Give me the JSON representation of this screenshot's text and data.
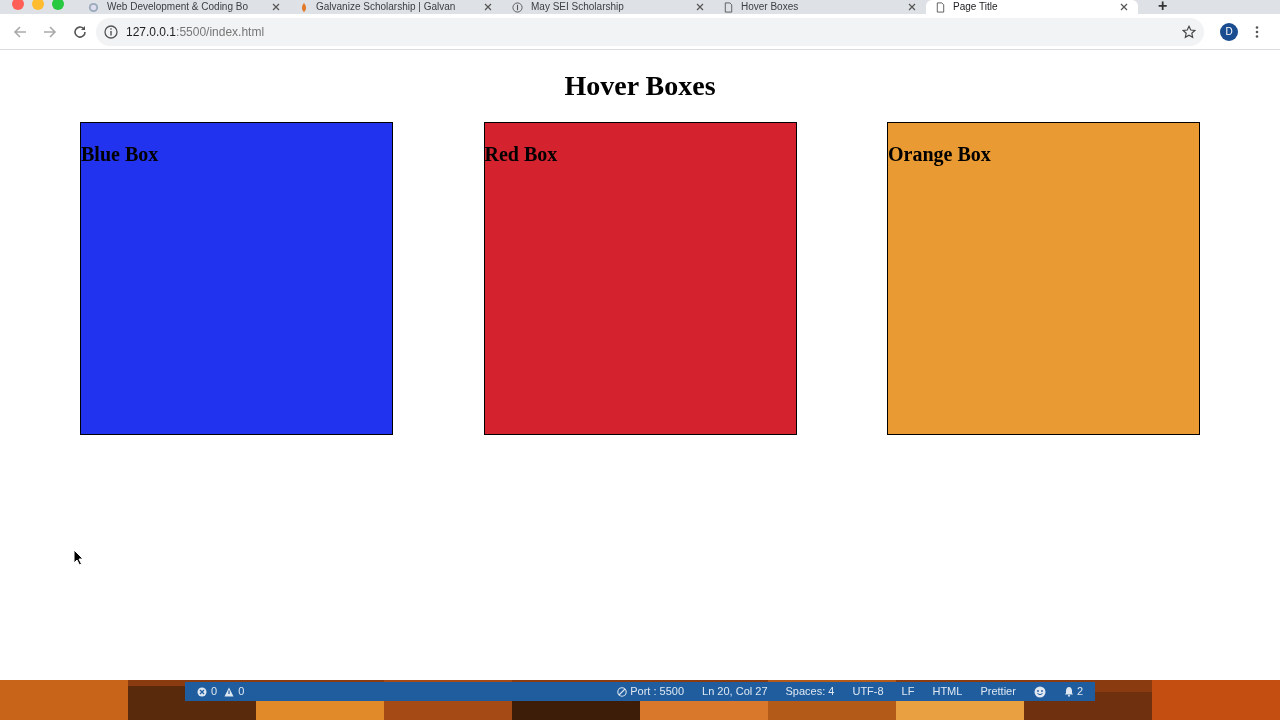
{
  "browser": {
    "tabs": [
      {
        "title": "Web Development & Coding Bo",
        "selected": false
      },
      {
        "title": "Galvanize Scholarship | Galvan",
        "selected": false
      },
      {
        "title": "May SEI Scholarship",
        "selected": false
      },
      {
        "title": "Hover Boxes",
        "selected": false
      },
      {
        "title": "Page Title",
        "selected": true
      }
    ],
    "new_tab": "+",
    "address": {
      "host": "127.0.0.1",
      "rest": ":5500/index.html"
    },
    "profile": "D"
  },
  "page": {
    "heading": "Hover Boxes",
    "boxes": [
      {
        "label": "Blue Box",
        "color": "#2233f0"
      },
      {
        "label": "Red Box",
        "color": "#d4232e"
      },
      {
        "label": "Orange Box",
        "color": "#e99a32"
      }
    ]
  },
  "status_bar": {
    "errors": "0",
    "warnings": "0",
    "items": [
      {
        "kind": "port",
        "text": "Port : 5500"
      },
      {
        "kind": "text",
        "text": "Ln 20, Col 27"
      },
      {
        "kind": "text",
        "text": "Spaces: 4"
      },
      {
        "kind": "text",
        "text": "UTF-8"
      },
      {
        "kind": "text",
        "text": "LF"
      },
      {
        "kind": "text",
        "text": "HTML"
      },
      {
        "kind": "text",
        "text": "Prettier"
      },
      {
        "kind": "smiley"
      },
      {
        "kind": "bell",
        "text": "2"
      }
    ]
  }
}
